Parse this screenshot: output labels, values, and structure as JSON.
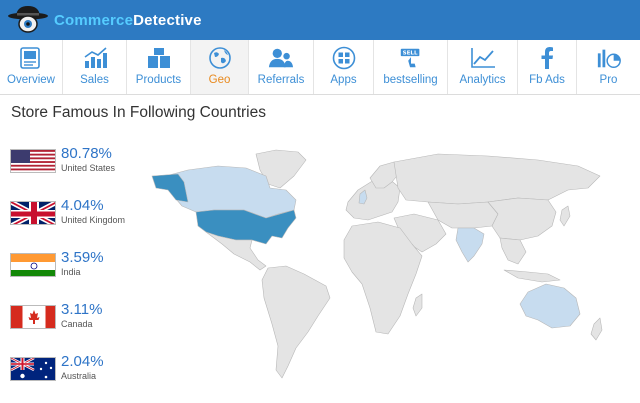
{
  "brand": {
    "name_part1": "Commerce",
    "name_part2": "Detective"
  },
  "colors": {
    "topbar": "#2d7ac2",
    "tab_label": "#3d8fd6",
    "active_tab_label": "#e8891d",
    "percent": "#2e74c7",
    "map_land": "#e4e4e4",
    "map_dark": "#3a8fc0",
    "map_light": "#c7dcef"
  },
  "nav": {
    "tabs": [
      {
        "label": "Overview",
        "icon": "overview-icon"
      },
      {
        "label": "Sales",
        "icon": "sales-chart-icon"
      },
      {
        "label": "Products",
        "icon": "products-icon"
      },
      {
        "label": "Geo",
        "icon": "geo-globe-icon",
        "active": true
      },
      {
        "label": "Referrals",
        "icon": "referrals-icon"
      },
      {
        "label": "Apps",
        "icon": "apps-grid-icon"
      },
      {
        "label": "bestselling",
        "icon": "sell-tag-icon"
      },
      {
        "label": "Analytics",
        "icon": "analytics-icon"
      },
      {
        "label": "Fb Ads",
        "icon": "facebook-icon"
      },
      {
        "label": "Pro",
        "icon": "pro-icon"
      }
    ]
  },
  "section": {
    "title": "Store Famous In Following Countries"
  },
  "countries": [
    {
      "percent": "80.78%",
      "name": "United States",
      "flag": "us-flag"
    },
    {
      "percent": "4.04%",
      "name": "United Kingdom",
      "flag": "uk-flag"
    },
    {
      "percent": "3.59%",
      "name": "India",
      "flag": "india-flag"
    },
    {
      "percent": "3.11%",
      "name": "Canada",
      "flag": "canada-flag"
    },
    {
      "percent": "2.04%",
      "name": "Australia",
      "flag": "australia-flag"
    }
  ]
}
